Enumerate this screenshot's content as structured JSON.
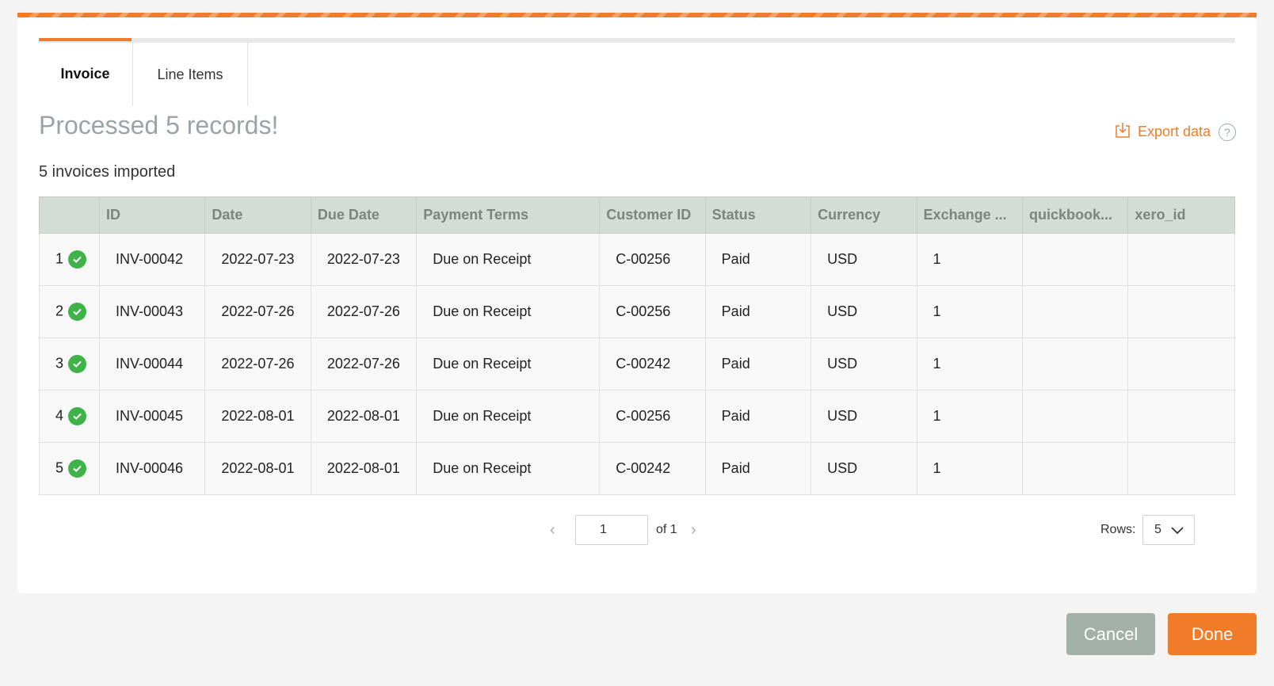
{
  "tabs": [
    {
      "label": "Invoice",
      "active": true
    },
    {
      "label": "Line Items",
      "active": false
    }
  ],
  "title": "Processed 5 records!",
  "subtitle": "5 invoices imported",
  "export": {
    "label": "Export data",
    "help": "?",
    "icon": "export-icon"
  },
  "colors": {
    "accent": "#f07c2a",
    "success": "#3fb24a",
    "header_bg": "#d4dcd6",
    "cancel": "#a3b0aa"
  },
  "table": {
    "headers": [
      "",
      "ID",
      "Date",
      "Due Date",
      "Payment Terms",
      "Customer ID",
      "Status",
      "Currency",
      "Exchange ...",
      "quickbook...",
      "xero_id"
    ],
    "rows": [
      {
        "num": "1",
        "id": "INV-00042",
        "date": "2022-07-23",
        "due": "2022-07-23",
        "terms": "Due on Receipt",
        "customer": "C-00256",
        "status": "Paid",
        "currency": "USD",
        "exchange": "1",
        "quickbooks": "",
        "xero": ""
      },
      {
        "num": "2",
        "id": "INV-00043",
        "date": "2022-07-26",
        "due": "2022-07-26",
        "terms": "Due on Receipt",
        "customer": "C-00256",
        "status": "Paid",
        "currency": "USD",
        "exchange": "1",
        "quickbooks": "",
        "xero": ""
      },
      {
        "num": "3",
        "id": "INV-00044",
        "date": "2022-07-26",
        "due": "2022-07-26",
        "terms": "Due on Receipt",
        "customer": "C-00242",
        "status": "Paid",
        "currency": "USD",
        "exchange": "1",
        "quickbooks": "",
        "xero": ""
      },
      {
        "num": "4",
        "id": "INV-00045",
        "date": "2022-08-01",
        "due": "2022-08-01",
        "terms": "Due on Receipt",
        "customer": "C-00256",
        "status": "Paid",
        "currency": "USD",
        "exchange": "1",
        "quickbooks": "",
        "xero": ""
      },
      {
        "num": "5",
        "id": "INV-00046",
        "date": "2022-08-01",
        "due": "2022-08-01",
        "terms": "Due on Receipt",
        "customer": "C-00242",
        "status": "Paid",
        "currency": "USD",
        "exchange": "1",
        "quickbooks": "",
        "xero": ""
      }
    ]
  },
  "pagination": {
    "page": "1",
    "of_label": "of 1",
    "rows_label": "Rows:",
    "rows_value": "5"
  },
  "buttons": {
    "cancel": "Cancel",
    "done": "Done"
  }
}
